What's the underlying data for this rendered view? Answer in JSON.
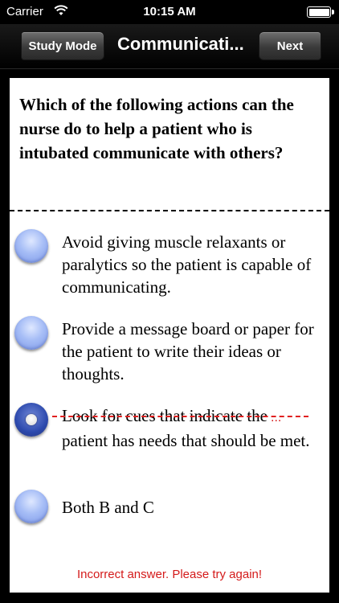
{
  "status_bar": {
    "carrier": "Carrier",
    "time": "10:15 AM"
  },
  "nav": {
    "back_label": "Study Mode",
    "title": "Communicati...",
    "next_label": "Next"
  },
  "question": "Which of the following actions can the nurse do to help a patient who is intubated communicate with others?",
  "options": [
    {
      "text": "Avoid giving muscle relaxants or paralytics so the patient is capable of communicating.",
      "selected": false
    },
    {
      "text": "Provide a message board or paper for the patient to write their ideas or thoughts.",
      "selected": false
    },
    {
      "text_struck": "Look for cues that indicate the",
      "ellipsis": "...",
      "text_rest": "patient has needs that should be met.",
      "selected": true,
      "incorrect": true
    },
    {
      "text": "Both B and C",
      "selected": false
    }
  ],
  "feedback": "Incorrect answer. Please try again!",
  "colors": {
    "feedback": "#d41a1a",
    "radio": "#a6bdf6",
    "radio_selected": "#2d4aae"
  }
}
